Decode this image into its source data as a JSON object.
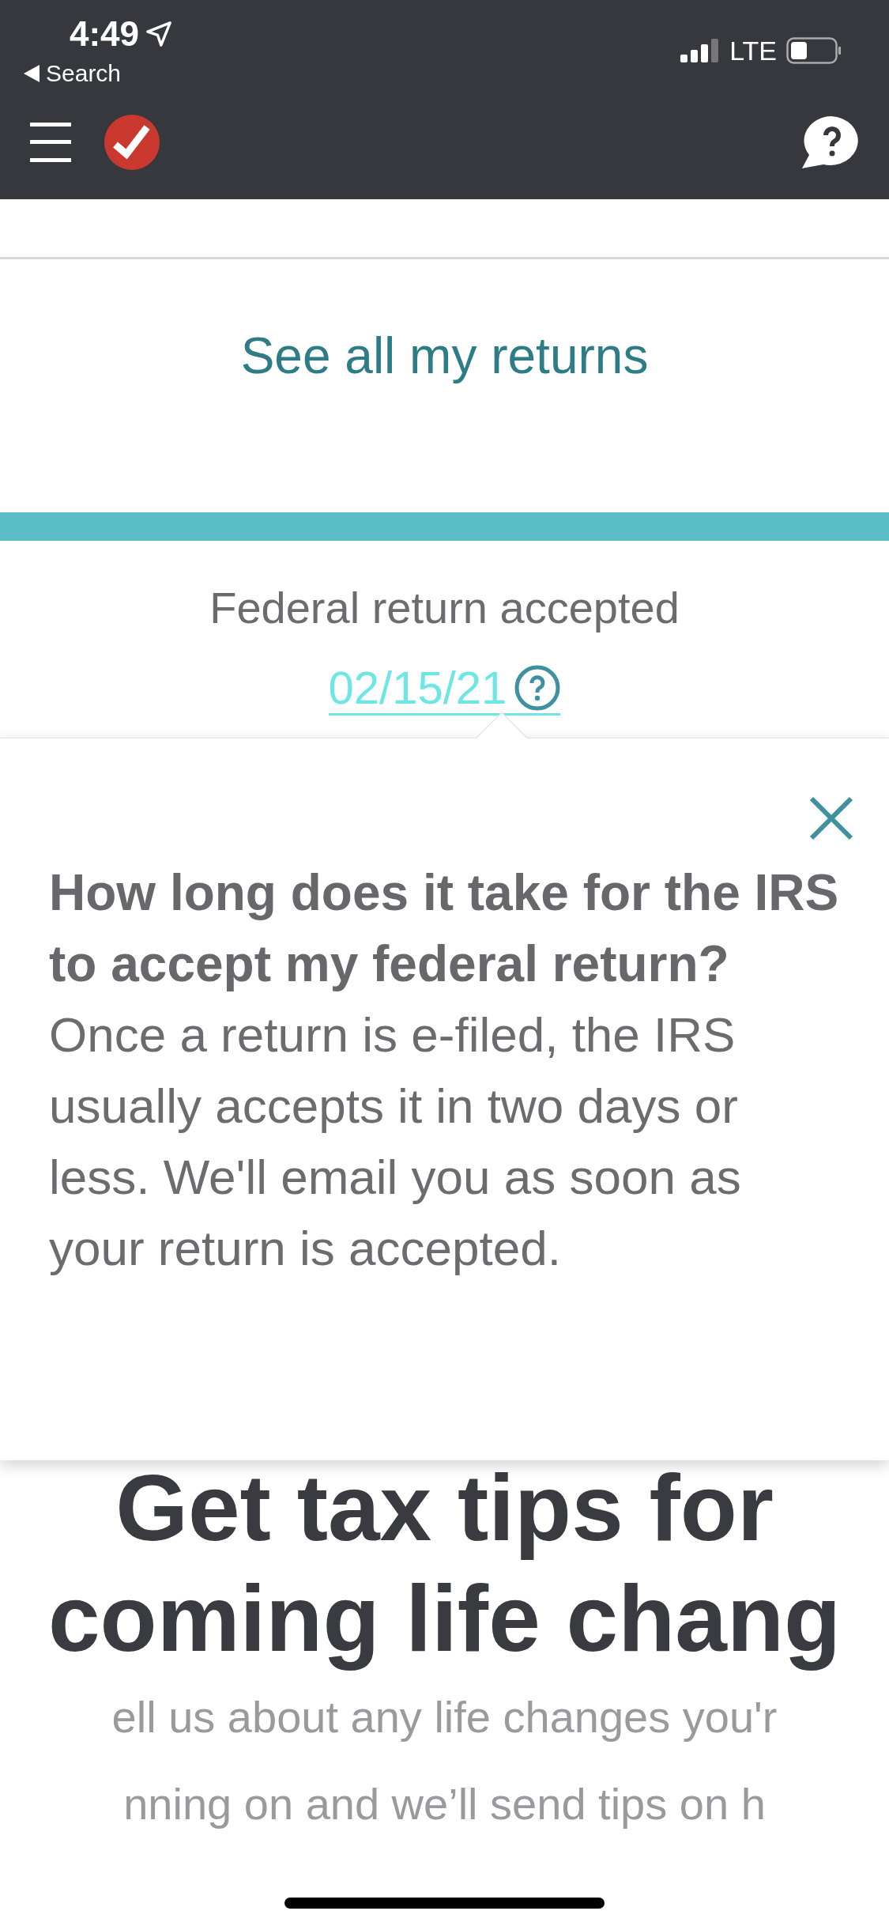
{
  "status_bar": {
    "time": "4:49",
    "back_label": "Search",
    "network": "LTE"
  },
  "returns_link": "See all my returns",
  "federal_status": {
    "label": "Federal return accepted",
    "date": "02/15/21"
  },
  "tooltip": {
    "title": "How long does it take for the IRS to accept my federal return?",
    "body": "Once a return is e-filed, the IRS usually accepts it in two days or less. We'll email you as soon as your return is accepted."
  },
  "promo": {
    "title_lines": [
      "Get tax tips for",
      "coming life chang"
    ],
    "body_lines": [
      "ell us about any life changes you'r",
      "nning on and we’ll send tips on h"
    ]
  }
}
